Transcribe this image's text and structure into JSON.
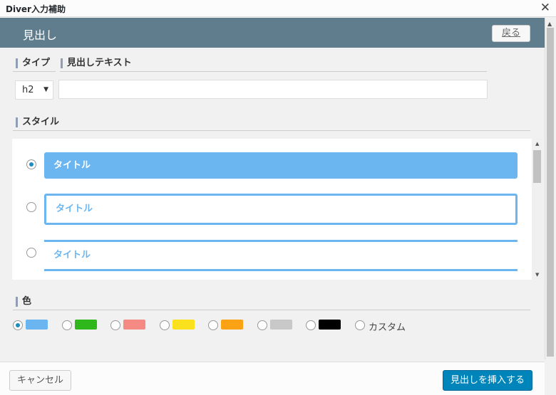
{
  "window": {
    "title": "Diver入力補助",
    "close_glyph": "✕"
  },
  "header": {
    "title": "見出し",
    "back_label": "戻る"
  },
  "fields": {
    "type_label": "タイプ",
    "heading_text_label": "見出しテキスト",
    "type_value": "h2",
    "heading_text_value": ""
  },
  "style": {
    "label": "スタイル",
    "options": [
      {
        "text": "タイトル",
        "selected": true
      },
      {
        "text": "タイトル",
        "selected": false
      },
      {
        "text": "タイトル",
        "selected": false
      }
    ]
  },
  "color": {
    "label": "色",
    "options": [
      {
        "hex": "#6bb6f0",
        "selected": true
      },
      {
        "hex": "#2eb81c",
        "selected": false
      },
      {
        "hex": "#f58a84",
        "selected": false
      },
      {
        "hex": "#fbe11d",
        "selected": false
      },
      {
        "hex": "#fba314",
        "selected": false
      },
      {
        "hex": "#c8c8c8",
        "selected": false
      },
      {
        "hex": "#000000",
        "selected": false
      }
    ],
    "custom_label": "カスタム"
  },
  "footer": {
    "cancel_label": "キャンセル",
    "insert_label": "見出しを挿入する"
  }
}
